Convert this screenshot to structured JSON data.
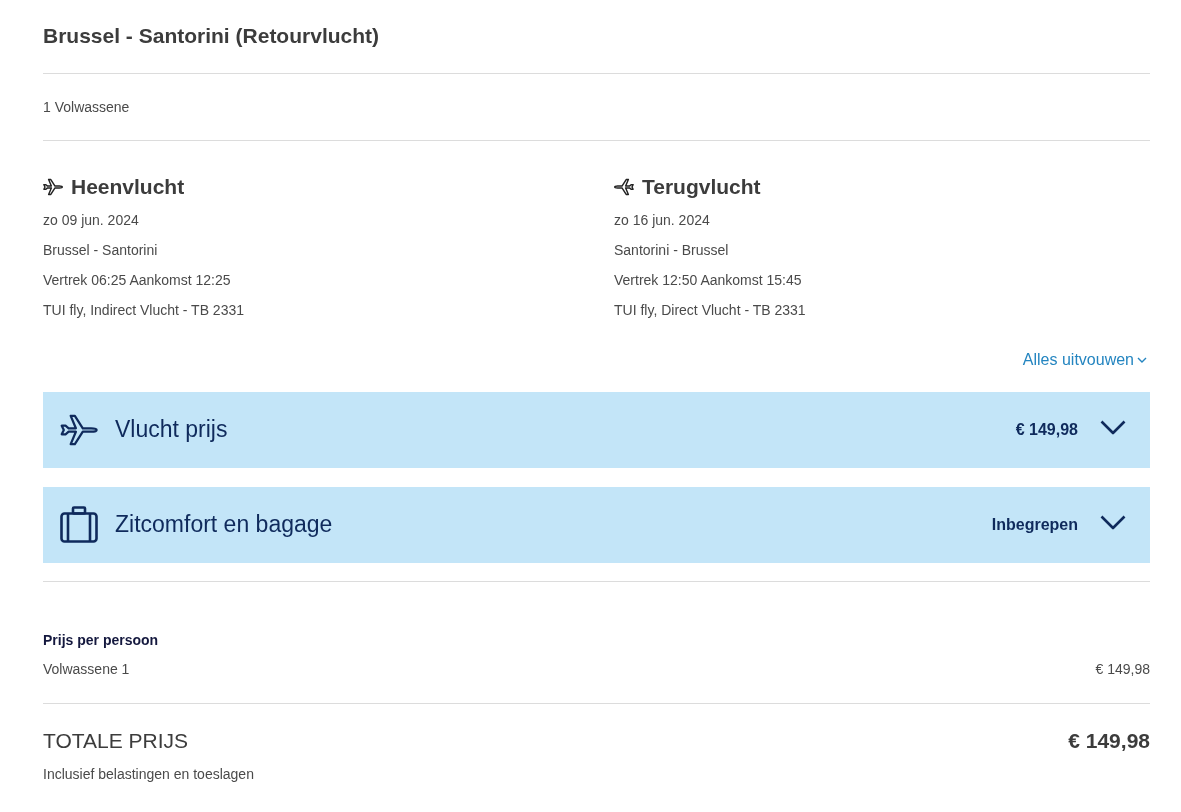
{
  "trip_title": "Brussel - Santorini (Retourvlucht)",
  "passengers": "1 Volwassene",
  "flights": [
    {
      "kind": "outbound",
      "heading": "Heenvlucht",
      "date": "zo 09 jun. 2024",
      "route": "Brussel - Santorini",
      "times": "Vertrek 06:25 Aankomst 12:25",
      "carrier": "TUI fly, Indirect Vlucht - TB 2331"
    },
    {
      "kind": "return",
      "heading": "Terugvlucht",
      "date": "zo 16 jun. 2024",
      "route": "Santorini - Brussel",
      "times": "Vertrek 12:50 Aankomst 15:45",
      "carrier": "TUI fly, Direct Vlucht - TB 2331"
    }
  ],
  "expand_all_link": "Alles uitvouwen",
  "panels": [
    {
      "kind": "flight",
      "title": "Vlucht prijs",
      "value": "€ 149,98",
      "expanded": false
    },
    {
      "kind": "baggage",
      "title": "Zitcomfort en bagage",
      "value": "Inbegrepen",
      "expanded": false
    }
  ],
  "price_per_person": {
    "heading": "Prijs per persoon",
    "rows": [
      {
        "label": "Volwassene 1",
        "price": "€ 149,98"
      }
    ]
  },
  "total": {
    "label": "TOTALE PRIJS",
    "price": "€ 149,98",
    "note": "Inclusief belastingen en toeslagen"
  }
}
